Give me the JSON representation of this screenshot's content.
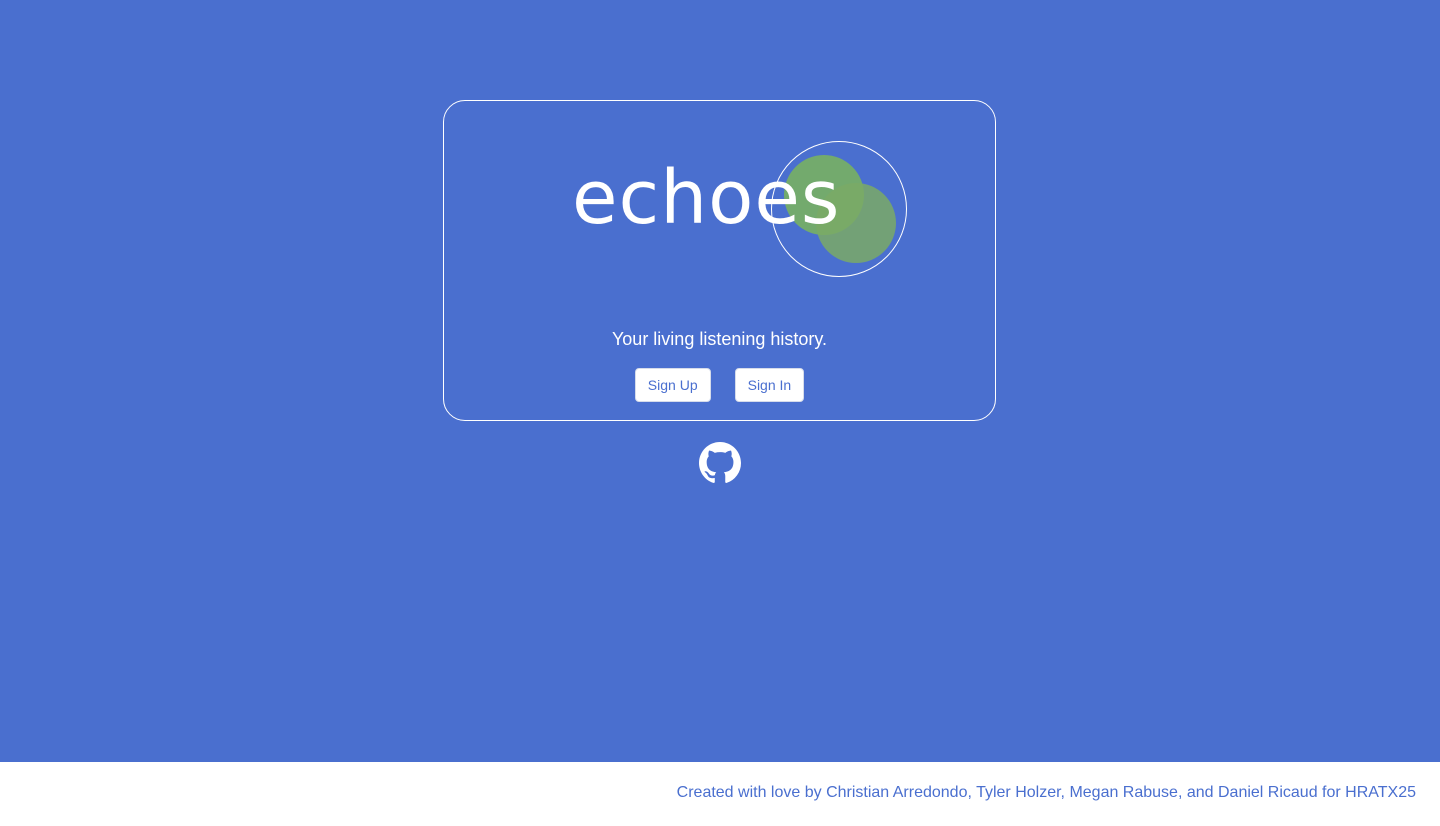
{
  "brand": {
    "name": "echoes",
    "tagline": "Your living listening history."
  },
  "actions": {
    "sign_up": "Sign Up",
    "sign_in": "Sign In"
  },
  "links": {
    "github_icon": "github-icon"
  },
  "footer": {
    "credit": "Created with love by Christian Arredondo, Tyler Holzer, Megan Rabuse, and Daniel Ricaud for HRATX25"
  },
  "colors": {
    "background": "#4a6fcf",
    "accent_green": "#7ab55c",
    "text_on_bg": "#ffffff",
    "footer_bg": "#ffffff",
    "footer_text": "#4a6fcf"
  }
}
